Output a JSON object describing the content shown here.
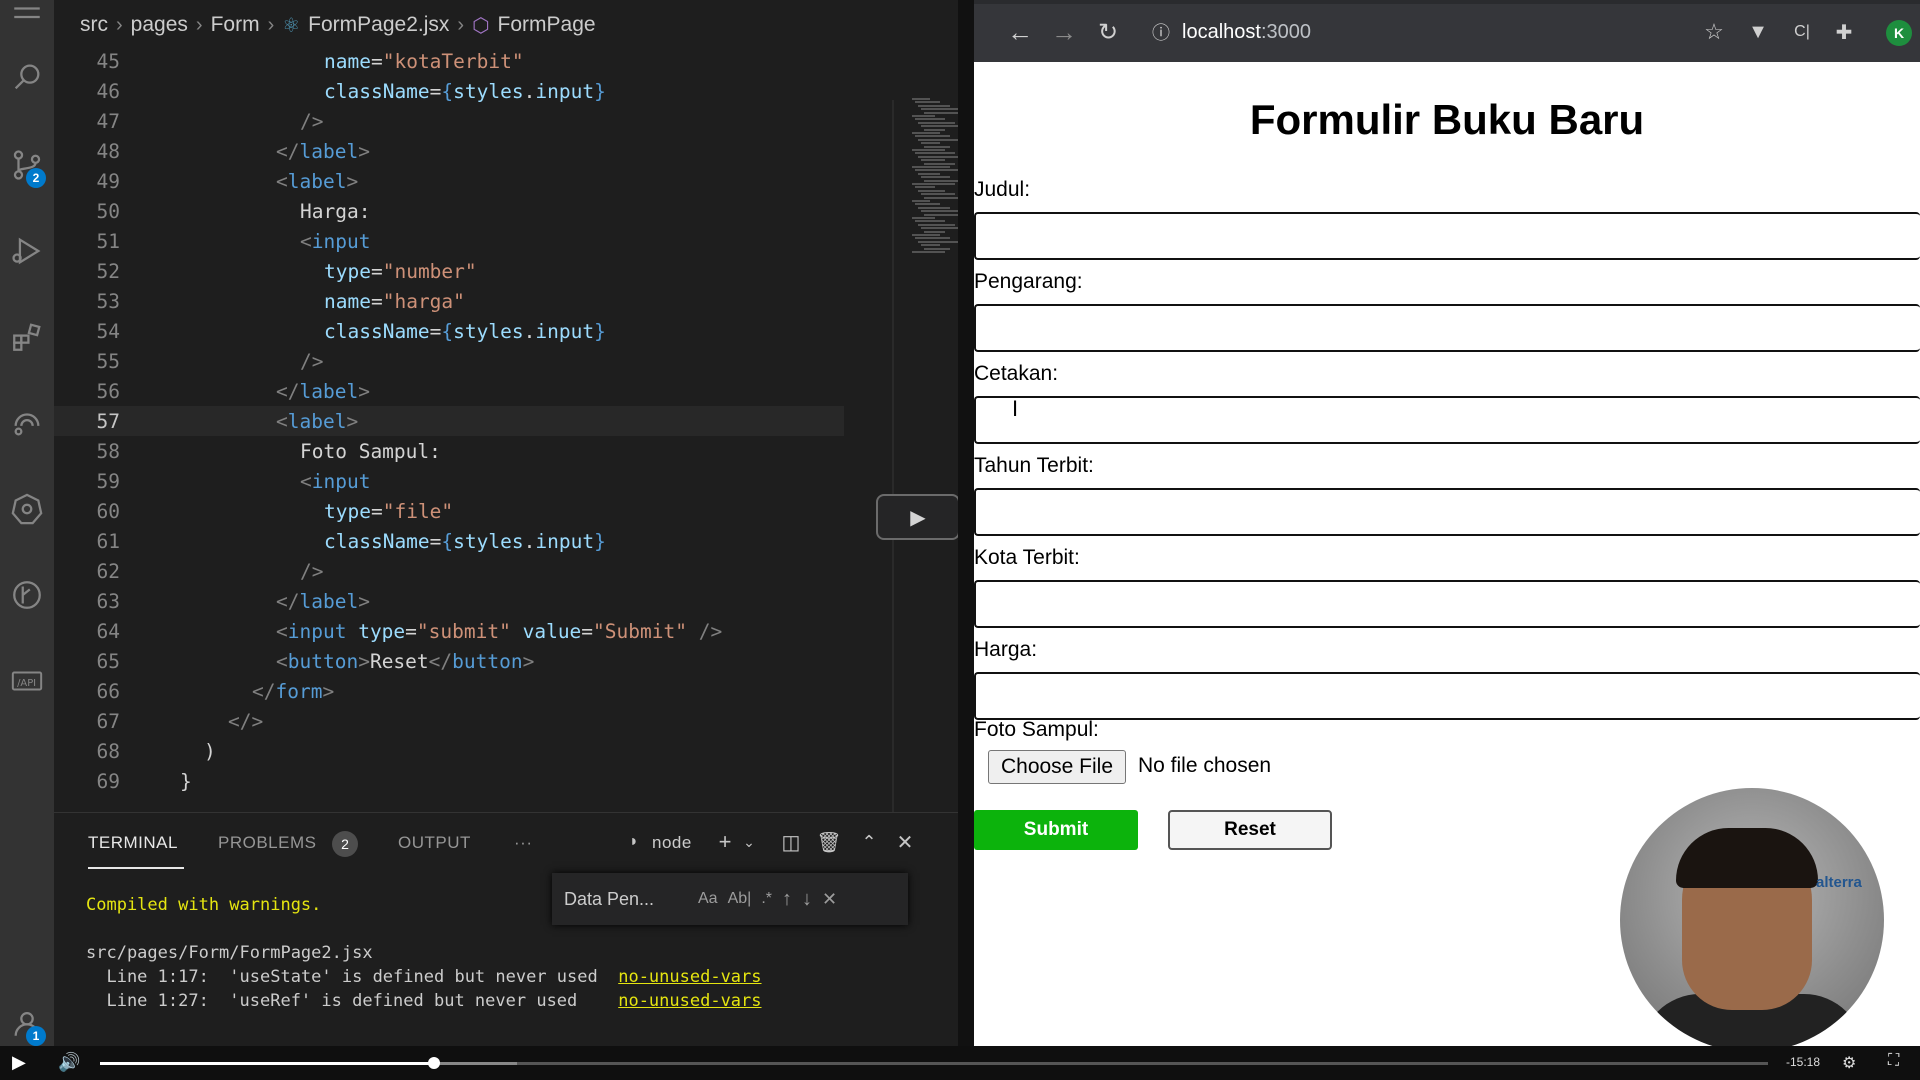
{
  "editor": {
    "breadcrumb": [
      "src",
      "pages",
      "Form",
      "FormPage2.jsx",
      "FormPage"
    ],
    "activity_badges": {
      "source_control": "2",
      "accounts": "1"
    },
    "active_line": "57",
    "lines": [
      {
        "n": "45",
        "html": "    <span class='t-attr'>name</span><span class='t-text'>=</span><span class='t-str'>\"kotaTerbit\"</span>"
      },
      {
        "n": "46",
        "html": "    <span class='t-attr'>className</span><span class='t-text'>=</span><span class='t-brace'>{</span><span class='t-attr'>styles</span><span class='t-text'>.</span><span class='t-attr'>input</span><span class='t-brace'>}</span>"
      },
      {
        "n": "47",
        "html": "  <span class='t-punc'>/&gt;</span>"
      },
      {
        "n": "48",
        "html": "<span class='t-punc'>&lt;/</span><span class='t-tag'>label</span><span class='t-punc'>&gt;</span>"
      },
      {
        "n": "49",
        "html": "<span class='t-punc'>&lt;</span><span class='t-tag'>label</span><span class='t-punc'>&gt;</span>"
      },
      {
        "n": "50",
        "html": "  <span class='t-text'>Harga:</span>"
      },
      {
        "n": "51",
        "html": "  <span class='t-punc'>&lt;</span><span class='t-tag'>input</span>"
      },
      {
        "n": "52",
        "html": "    <span class='t-attr'>type</span><span class='t-text'>=</span><span class='t-str'>\"number\"</span>"
      },
      {
        "n": "53",
        "html": "    <span class='t-attr'>name</span><span class='t-text'>=</span><span class='t-str'>\"harga\"</span>"
      },
      {
        "n": "54",
        "html": "    <span class='t-attr'>className</span><span class='t-text'>=</span><span class='t-brace'>{</span><span class='t-attr'>styles</span><span class='t-text'>.</span><span class='t-attr'>input</span><span class='t-brace'>}</span>"
      },
      {
        "n": "55",
        "html": "  <span class='t-punc'>/&gt;</span>"
      },
      {
        "n": "56",
        "html": "<span class='t-punc'>&lt;/</span><span class='t-tag'>label</span><span class='t-punc'>&gt;</span>"
      },
      {
        "n": "57",
        "html": "<span class='t-punc'>&lt;</span><span class='t-tag'>label</span><span class='t-punc'>&gt;</span>"
      },
      {
        "n": "58",
        "html": "  <span class='t-text'>Foto Sampul:</span>"
      },
      {
        "n": "59",
        "html": "  <span class='t-punc'>&lt;</span><span class='t-tag'>input</span>"
      },
      {
        "n": "60",
        "html": "    <span class='t-attr'>type</span><span class='t-text'>=</span><span class='t-str'>\"file\"</span>"
      },
      {
        "n": "61",
        "html": "    <span class='t-attr'>className</span><span class='t-text'>=</span><span class='t-brace'>{</span><span class='t-attr'>styles</span><span class='t-text'>.</span><span class='t-attr'>input</span><span class='t-brace'>}</span>"
      },
      {
        "n": "62",
        "html": "  <span class='t-punc'>/&gt;</span>"
      },
      {
        "n": "63",
        "html": "<span class='t-punc'>&lt;/</span><span class='t-tag'>label</span><span class='t-punc'>&gt;</span>"
      },
      {
        "n": "64",
        "html": "<span class='t-punc'>&lt;</span><span class='t-tag'>input</span> <span class='t-attr'>type</span><span class='t-text'>=</span><span class='t-str'>\"submit\"</span> <span class='t-attr'>value</span><span class='t-text'>=</span><span class='t-str'>\"Submit\"</span> <span class='t-punc'>/&gt;</span>"
      },
      {
        "n": "65",
        "html": "<span class='t-punc'>&lt;</span><span class='t-tag'>button</span><span class='t-punc'>&gt;</span><span class='t-text'>Reset</span><span class='t-punc'>&lt;/</span><span class='t-tag'>button</span><span class='t-punc'>&gt;</span>"
      },
      {
        "n": "66",
        "html": "<span class='t-punc'>&lt;/</span><span class='t-tag'>form</span><span class='t-punc'>&gt;</span>"
      },
      {
        "n": "67",
        "html": "<span class='t-punc'>&lt;/&gt;</span>"
      },
      {
        "n": "68",
        "html": "<span class='t-text'>)</span>"
      },
      {
        "n": "69",
        "html": "<span class='t-text'>}</span>"
      }
    ]
  },
  "panel": {
    "tabs": [
      "TERMINAL",
      "PROBLEMS",
      "OUTPUT",
      "···"
    ],
    "problems_count": "2",
    "shell": "node",
    "find_text": "Data Pen...",
    "find_options": [
      "Aa",
      "Ab|",
      ".*"
    ],
    "terminal_lines": [
      {
        "text": "Compiled with warnings.",
        "cls": "warn"
      },
      {
        "text": "",
        "cls": ""
      },
      {
        "text": "src/pages/Form/FormPage2.jsx",
        "cls": ""
      },
      {
        "text": "  Line 1:17:  'useState' is defined but never used  ",
        "cls": "",
        "link": "no-unused-vars"
      },
      {
        "text": "  Line 1:27:  'useRef' is defined but never used    ",
        "cls": "",
        "link": "no-unused-vars"
      }
    ]
  },
  "browser": {
    "url_host": "localhost",
    "url_port": ":3000",
    "profile_initial": "K",
    "page_title": "Formulir Buku Baru",
    "fields": [
      {
        "label": "Judul:"
      },
      {
        "label": "Pengarang:"
      },
      {
        "label": "Cetakan:"
      },
      {
        "label": "Tahun Terbit:"
      },
      {
        "label": "Kota Terbit:"
      },
      {
        "label": "Harga:"
      }
    ],
    "file_label": "Foto Sampul:",
    "file_button": "Choose File",
    "file_status": "No file chosen",
    "submit_label": "Submit",
    "reset_label": "Reset",
    "webcam_logo": "alterra"
  },
  "video": {
    "progress": 0.2,
    "buffered": 0.25,
    "time_remaining": "-15:18"
  }
}
